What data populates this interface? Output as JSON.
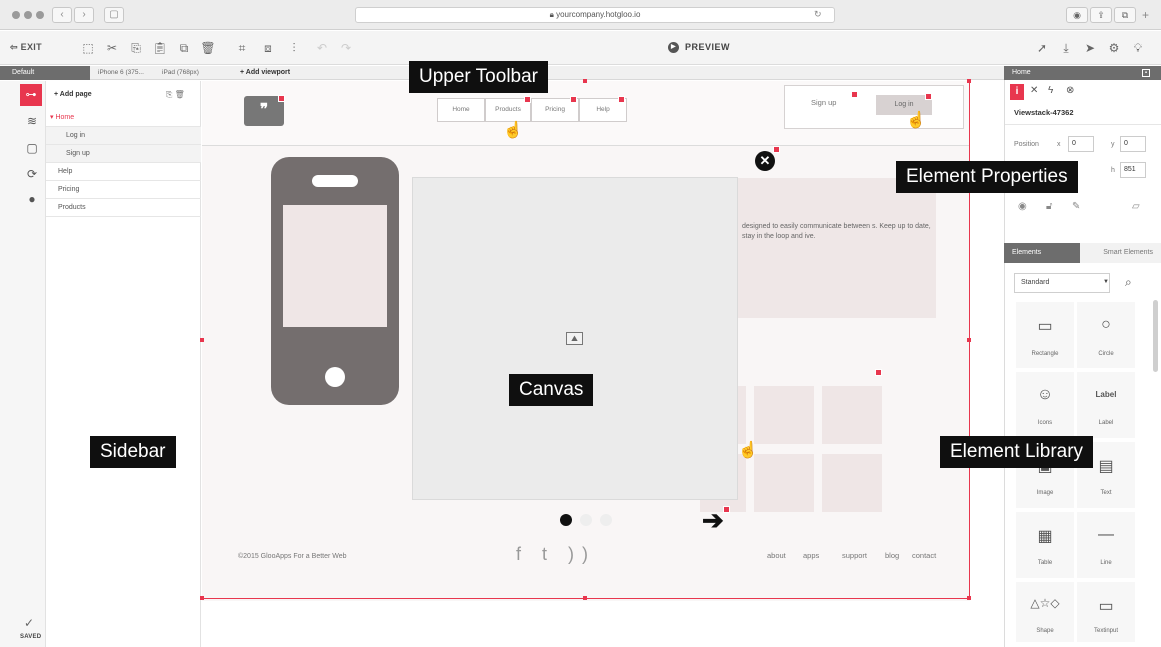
{
  "browser": {
    "url": "yourcompany.hotgloo.io",
    "nav_back": "‹",
    "nav_forward": "›"
  },
  "toolbar": {
    "exit_label": "EXIT",
    "preview_label": "PREVIEW"
  },
  "viewports": {
    "default_label": "Default",
    "tabs": [
      "iPhone 6 (375...",
      "iPad (768px)"
    ],
    "add_label": "Add viewport"
  },
  "sidebar": {
    "add_page_label": "Add page",
    "pages": [
      {
        "label": "Home",
        "active": true
      },
      {
        "label": "Log in",
        "sub": true
      },
      {
        "label": "Sign up",
        "sub": true
      },
      {
        "label": "Help"
      },
      {
        "label": "Pricing"
      },
      {
        "label": "Products"
      }
    ],
    "saved_label": "SAVED"
  },
  "canvas": {
    "nav_items": [
      "Home",
      "Products",
      "Pricing",
      "Help"
    ],
    "signup_label": "Sign up",
    "login_label": "Log in",
    "banner_text": "designed to easily communicate between s. Keep up to date, stay in the loop and ive.",
    "footer_copyright": "©2015 GlooApps For a Better Web",
    "footer_social": "f t ))",
    "footer_links": [
      "about",
      "apps",
      "support",
      "blog",
      "contact"
    ]
  },
  "properties": {
    "panel_title": "Home",
    "element_id": "Viewstack-47362",
    "position_label": "Position",
    "x_label": "x",
    "x_value": "0",
    "y_label": "y",
    "y_value": "0",
    "h_label": "h",
    "h_value": "851"
  },
  "library": {
    "tabs": [
      "Elements",
      "Smart Elements"
    ],
    "select_value": "Standard",
    "items": [
      {
        "label": "Rectangle",
        "icon": "rectangle-icon",
        "glyph": "▭"
      },
      {
        "label": "Circle",
        "icon": "circle-icon",
        "glyph": "○"
      },
      {
        "label": "Icons",
        "icon": "smiley-icon",
        "glyph": "☺"
      },
      {
        "label": "Label",
        "icon": "label-icon",
        "glyph": "Label"
      },
      {
        "label": "Image",
        "icon": "image-icon",
        "glyph": "▣"
      },
      {
        "label": "Text",
        "icon": "text-icon",
        "glyph": "▤"
      },
      {
        "label": "Table",
        "icon": "table-icon",
        "glyph": "▦"
      },
      {
        "label": "Line",
        "icon": "line-icon",
        "glyph": "—"
      },
      {
        "label": "Shape",
        "icon": "shape-icon",
        "glyph": "△☆◇"
      },
      {
        "label": "Textinput",
        "icon": "textinput-icon",
        "glyph": "▭"
      }
    ]
  },
  "callouts": {
    "upper_toolbar": "Upper Toolbar",
    "element_properties": "Element Properties",
    "canvas": "Canvas",
    "sidebar": "Sidebar",
    "element_library": "Element Library"
  },
  "colors": {
    "accent": "#e8364e",
    "panel_header": "#6d6d6d",
    "phone": "#746e6e"
  }
}
